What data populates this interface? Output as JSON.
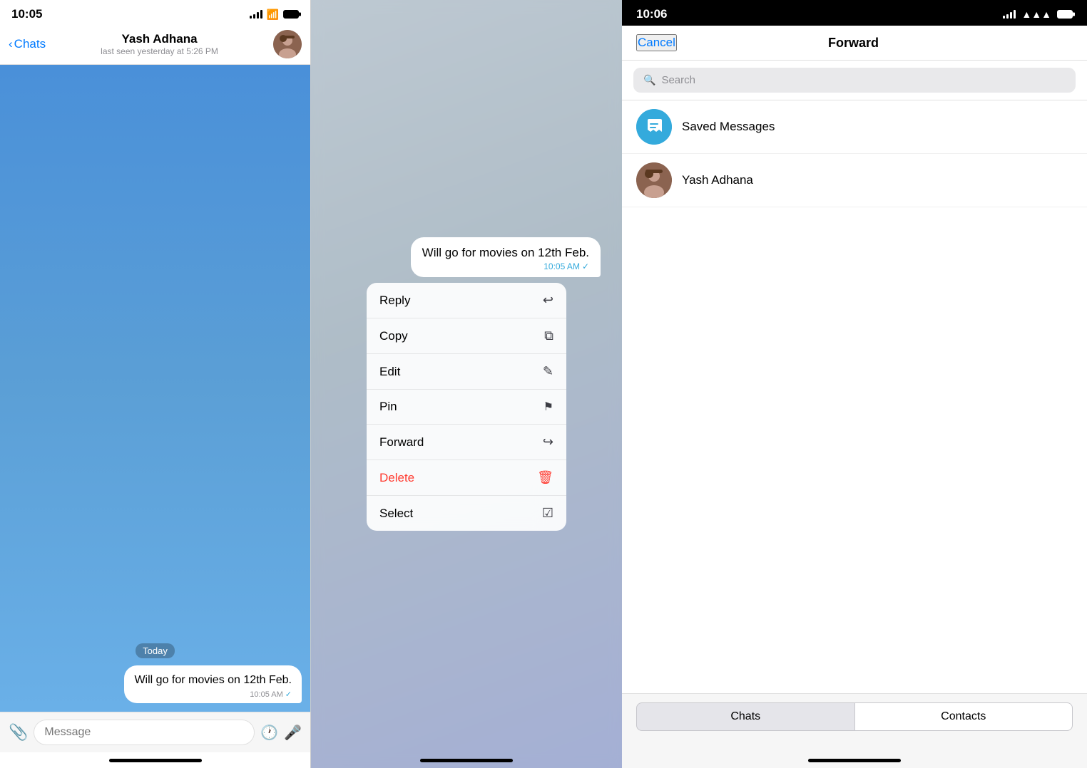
{
  "panel1": {
    "statusBar": {
      "time": "10:05"
    },
    "navBar": {
      "backLabel": "Chats",
      "contactName": "Yash Adhana",
      "contactStatus": "last seen yesterday at 5:26 PM"
    },
    "messages": {
      "dateBadge": "Today",
      "items": [
        {
          "text": "Will go for movies on 12th Feb.",
          "time": "10:05 AM",
          "check": "✓"
        }
      ]
    },
    "inputBar": {
      "placeholder": "Message"
    }
  },
  "panel2": {
    "messageBubble": {
      "text": "Will go for movies on 12th Feb.",
      "time": "10:05 AM",
      "check": "✓"
    },
    "contextMenu": {
      "items": [
        {
          "label": "Reply",
          "icon": "↩",
          "isDelete": false
        },
        {
          "label": "Copy",
          "icon": "⧉",
          "isDelete": false
        },
        {
          "label": "Edit",
          "icon": "✎",
          "isDelete": false
        },
        {
          "label": "Pin",
          "icon": "📌",
          "isDelete": false
        },
        {
          "label": "Forward",
          "icon": "↪",
          "isDelete": false
        },
        {
          "label": "Delete",
          "icon": "🗑",
          "isDelete": true
        },
        {
          "label": "Select",
          "icon": "✓",
          "isDelete": false
        }
      ]
    }
  },
  "panel3": {
    "statusBar": {
      "time": "10:06"
    },
    "navBar": {
      "cancelLabel": "Cancel",
      "title": "Forward"
    },
    "searchBar": {
      "placeholder": "Search"
    },
    "contacts": [
      {
        "name": "Saved Messages",
        "type": "saved"
      },
      {
        "name": "Yash Adhana",
        "type": "yash"
      }
    ],
    "tabs": [
      {
        "label": "Chats",
        "active": true
      },
      {
        "label": "Contacts",
        "active": false
      }
    ]
  }
}
